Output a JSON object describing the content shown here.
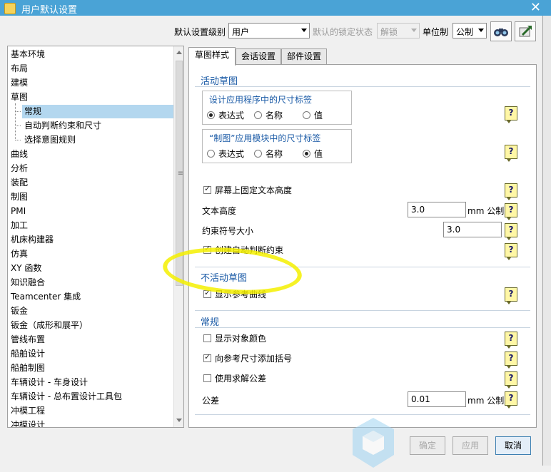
{
  "window": {
    "title": "用户默认设置",
    "close_glyph": "✕"
  },
  "toolbar": {
    "level_label": "默认设置级别",
    "level_value": "用户",
    "lock_label": "默认的锁定状态",
    "lock_value": "解锁",
    "unit_label": "单位制",
    "unit_value": "公制",
    "search_icon": "binoculars-icon",
    "export_icon": "export-icon"
  },
  "tree": {
    "items": [
      "基本环境",
      "布局",
      "建模",
      "草图",
      "常规",
      "自动判断约束和尺寸",
      "选择意图规则",
      "曲线",
      "分析",
      "装配",
      "制图",
      "PMI",
      "加工",
      "机床构建器",
      "仿真",
      "XY 函数",
      "知识融合",
      "Teamcenter 集成",
      "钣金",
      "钣金（成形和展平）",
      "管线布置",
      "船舶设计",
      "船舶制图",
      "车辆设计 - 车身设计",
      "车辆设计 - 总布置设计工具包",
      "冲模工程",
      "冲模设计"
    ],
    "selected": "常规"
  },
  "tabs": [
    "草图样式",
    "会话设置",
    "部件设置"
  ],
  "active_sketch": {
    "heading": "活动草图",
    "group1_title": "设计应用程序中的尺寸标签",
    "group1_options": [
      "表达式",
      "名称",
      "值"
    ],
    "group2_title": "“制图”应用模块中的尺寸标签",
    "group2_options": [
      "表达式",
      "名称",
      "值"
    ],
    "fix_text_height": "屏幕上固定文本高度",
    "text_height_label": "文本高度",
    "text_height_value": "3.0",
    "text_height_unit": "mm 公制",
    "constraint_size_label": "约束符号大小",
    "constraint_size_value": "3.0",
    "auto_constraints": "创建自动判断约束"
  },
  "inactive_sketch": {
    "heading": "不活动草图",
    "show_ref_curves": "显示参考曲线"
  },
  "general": {
    "heading": "常规",
    "show_object_color": "显示对象颜色",
    "add_parens": "向参考尺寸添加括号",
    "use_solver_tolerance": "使用求解公差",
    "tolerance_label": "公差",
    "tolerance_value": "0.01",
    "tolerance_unit": "mm 公制"
  },
  "help_glyph": "?",
  "buttons": {
    "ok": "确定",
    "apply": "应用",
    "cancel": "取消"
  },
  "colors": {
    "titlebar": "#4aa3d6",
    "section_heading": "#1a5aa6",
    "selection": "#b3d7ef",
    "annotation": "#f4f000"
  }
}
